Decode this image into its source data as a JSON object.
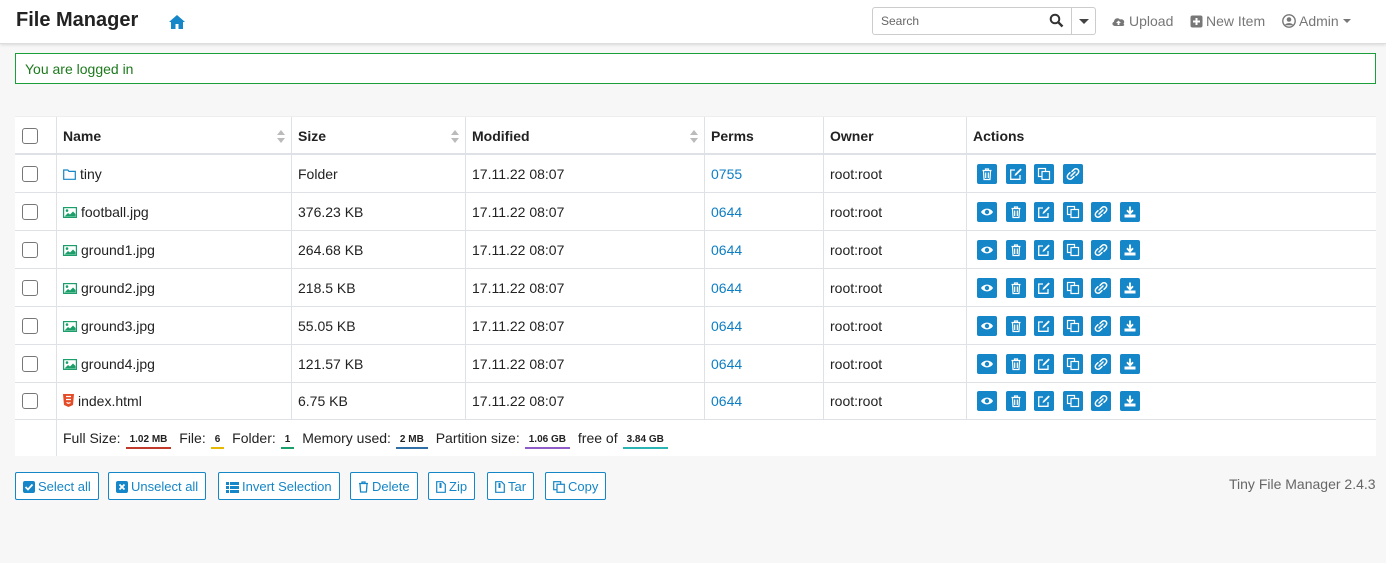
{
  "header": {
    "title": "File Manager",
    "search_placeholder": "Search",
    "upload_label": "Upload",
    "new_item_label": "New Item",
    "admin_label": "Admin"
  },
  "alert": {
    "message": "You are logged in"
  },
  "table": {
    "headers": {
      "name": "Name",
      "size": "Size",
      "modified": "Modified",
      "perms": "Perms",
      "owner": "Owner",
      "actions": "Actions"
    },
    "rows": [
      {
        "name": "tiny",
        "type": "folder",
        "size": "Folder",
        "modified": "17.11.22 08:07",
        "perms": "0755",
        "owner": "root:root"
      },
      {
        "name": "football.jpg",
        "type": "image",
        "size": "376.23 KB",
        "modified": "17.11.22 08:07",
        "perms": "0644",
        "owner": "root:root"
      },
      {
        "name": "ground1.jpg",
        "type": "image",
        "size": "264.68 KB",
        "modified": "17.11.22 08:07",
        "perms": "0644",
        "owner": "root:root"
      },
      {
        "name": "ground2.jpg",
        "type": "image",
        "size": "218.5 KB",
        "modified": "17.11.22 08:07",
        "perms": "0644",
        "owner": "root:root"
      },
      {
        "name": "ground3.jpg",
        "type": "image",
        "size": "55.05 KB",
        "modified": "17.11.22 08:07",
        "perms": "0644",
        "owner": "root:root"
      },
      {
        "name": "ground4.jpg",
        "type": "image",
        "size": "121.57 KB",
        "modified": "17.11.22 08:07",
        "perms": "0644",
        "owner": "root:root"
      },
      {
        "name": "index.html",
        "type": "html",
        "size": "6.75 KB",
        "modified": "17.11.22 08:07",
        "perms": "0644",
        "owner": "root:root"
      }
    ],
    "footer": {
      "full_size_label": "Full Size:",
      "full_size_value": "1.02 MB",
      "file_label": "File:",
      "file_value": "6",
      "folder_label": "Folder:",
      "folder_value": "1",
      "memory_label": "Memory used:",
      "memory_value": "2 MB",
      "partition_label": "Partition size:",
      "partition_value": "1.06 GB",
      "free_label": "free of",
      "free_value": "3.84 GB"
    }
  },
  "actions": {
    "select_all": "Select all",
    "unselect_all": "Unselect all",
    "invert_selection": "Invert Selection",
    "delete": "Delete",
    "zip": "Zip",
    "tar": "Tar",
    "copy": "Copy"
  },
  "version": "Tiny File Manager 2.4.3",
  "colors": {
    "accent": "#1586c7",
    "success": "#1a9f3a",
    "badge_full_size": "#c0392b",
    "badge_file": "#e6b800",
    "badge_folder": "#1a9f6a",
    "badge_memory": "#2f6fa6",
    "badge_partition": "#8e5bc7",
    "badge_free": "#2ab4b4"
  }
}
